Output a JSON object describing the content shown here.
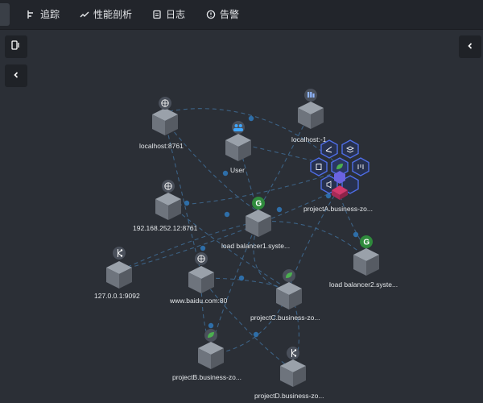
{
  "tabs": [
    {
      "label": "追踪",
      "icon": "trace-icon"
    },
    {
      "label": "性能剖析",
      "icon": "trend-icon"
    },
    {
      "label": "日志",
      "icon": "log-icon"
    },
    {
      "label": "告警",
      "icon": "alert-icon"
    }
  ],
  "colors": {
    "background": "#2b2f36",
    "topbar": "#22252b",
    "edge": "#3f6b93",
    "cube_top": "#9aa1aa",
    "cube_left": "#6e747d",
    "cube_right": "#565b63",
    "badge": "#4a505b",
    "spring_green": "#4caf50",
    "hex_blue": "#3f5fd0",
    "hex_pink": "#d2386c"
  },
  "nodes": [
    {
      "id": "localhost8761",
      "label": "localhost:8761",
      "badge": "globe-icon"
    },
    {
      "id": "user",
      "label": "User",
      "badge": "users-icon"
    },
    {
      "id": "localhost1",
      "label": "localhost:-1",
      "badge": "database-icon"
    },
    {
      "id": "projectA",
      "label": "projectA.business-zo...",
      "badge": "spring-icon"
    },
    {
      "id": "ip8761",
      "label": "192.168.252.12:8761",
      "badge": "globe-icon"
    },
    {
      "id": "lb1",
      "label": "load balancer1.syste...",
      "badge": "gateway-g-icon"
    },
    {
      "id": "lb2",
      "label": "load balancer2.syste...",
      "badge": "gateway-g-icon"
    },
    {
      "id": "local9092",
      "label": "127.0.0.1:9092",
      "badge": "kafka-icon"
    },
    {
      "id": "baidu",
      "label": "www.baidu.com:80",
      "badge": "globe-icon"
    },
    {
      "id": "projectC",
      "label": "projectC.business-zo...",
      "badge": "spring-icon"
    },
    {
      "id": "projectB",
      "label": "projectB.business-zo...",
      "badge": "spring-icon"
    },
    {
      "id": "projectD",
      "label": "projectD.business-zo...",
      "badge": "kafka-icon"
    }
  ],
  "hex_menu": [
    "share-icon",
    "layers-icon",
    "spring-icon",
    "clipboard-icon",
    "metrics-icon",
    "alarm-icon",
    "blank"
  ]
}
